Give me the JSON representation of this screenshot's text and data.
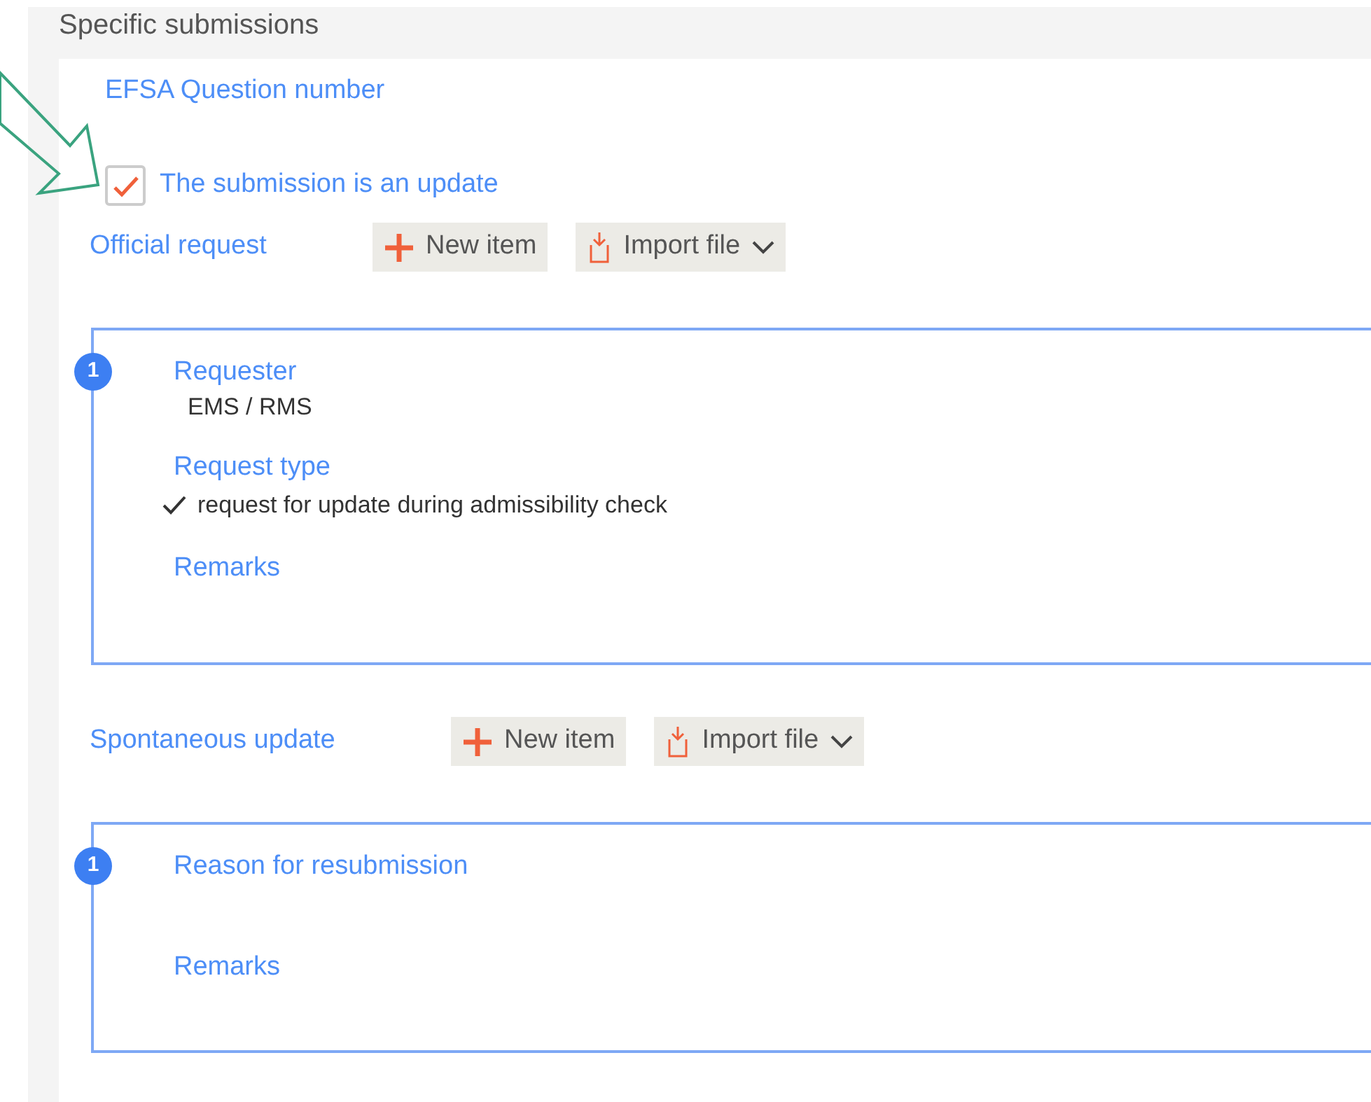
{
  "panel": {
    "title": "Specific submissions"
  },
  "question_number": {
    "label": "EFSA Question number"
  },
  "update_checkbox": {
    "label": "The submission is an update",
    "checked": true
  },
  "sections": [
    {
      "label": "Official request",
      "buttons": [
        {
          "kind": "new",
          "label": "New item"
        },
        {
          "kind": "import",
          "label": "Import file"
        }
      ],
      "items": [
        {
          "number": "1",
          "fields": [
            {
              "kind": "text",
              "label": "Requester",
              "value": "EMS / RMS"
            },
            {
              "kind": "choice",
              "label": "Request type",
              "value": "request for update during admissibility check"
            },
            {
              "kind": "empty",
              "label": "Remarks"
            }
          ]
        }
      ]
    },
    {
      "label": "Spontaneous update",
      "buttons": [
        {
          "kind": "new",
          "label": "New item"
        },
        {
          "kind": "import",
          "label": "Import file"
        }
      ],
      "items": [
        {
          "number": "1",
          "fields": [
            {
              "kind": "empty",
              "label": "Reason for resubmission"
            },
            {
              "kind": "empty",
              "label": "Remarks"
            }
          ]
        }
      ]
    }
  ]
}
